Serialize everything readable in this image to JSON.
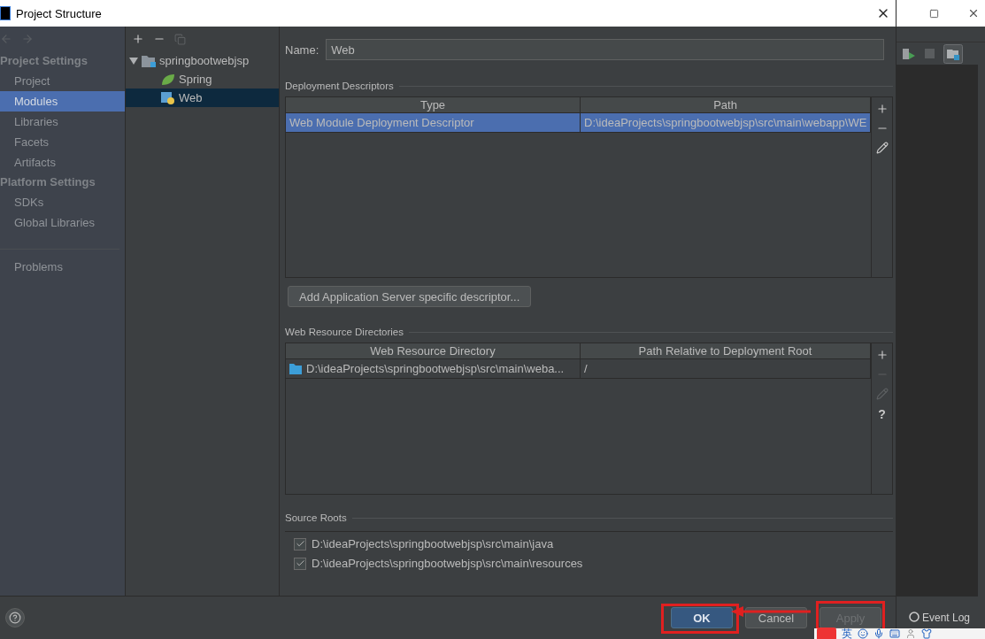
{
  "window": {
    "title": "Project Structure"
  },
  "sidebar": {
    "sections": [
      {
        "heading": "Project Settings",
        "items": [
          {
            "label": "Project",
            "selected": false
          },
          {
            "label": "Modules",
            "selected": true
          },
          {
            "label": "Libraries",
            "selected": false
          },
          {
            "label": "Facets",
            "selected": false
          },
          {
            "label": "Artifacts",
            "selected": false
          }
        ]
      },
      {
        "heading": "Platform Settings",
        "items": [
          {
            "label": "SDKs",
            "selected": false
          },
          {
            "label": "Global Libraries",
            "selected": false
          }
        ]
      }
    ],
    "footer_items": [
      {
        "label": "Problems",
        "selected": false
      }
    ]
  },
  "module_tree": {
    "nodes": [
      {
        "label": "springbootwebjsp",
        "kind": "module",
        "expanded": true,
        "selected": false,
        "children": [
          {
            "label": "Spring",
            "kind": "spring",
            "selected": false
          },
          {
            "label": "Web",
            "kind": "web",
            "selected": true
          }
        ]
      }
    ]
  },
  "name_field": {
    "label": "Name:",
    "value": "Web"
  },
  "deployment_descriptors": {
    "title": "Deployment Descriptors",
    "columns": [
      "Type",
      "Path"
    ],
    "rows": [
      {
        "cells": [
          "Web Module Deployment Descriptor",
          "D:\\ideaProjects\\springbootwebjsp\\src\\main\\webapp\\WE"
        ],
        "selected": true
      }
    ],
    "tools": [
      {
        "kind": "add",
        "disabled": false
      },
      {
        "kind": "remove",
        "disabled": false
      },
      {
        "kind": "edit",
        "disabled": false
      }
    ],
    "button": "Add Application Server specific descriptor..."
  },
  "web_resource_directories": {
    "title": "Web Resource Directories",
    "columns": [
      "Web Resource Directory",
      "Path Relative to Deployment Root"
    ],
    "rows": [
      {
        "cells": [
          "D:\\ideaProjects\\springbootwebjsp\\src\\main\\weba...",
          "/"
        ],
        "selected": false
      }
    ],
    "tools": [
      {
        "kind": "add",
        "disabled": false
      },
      {
        "kind": "remove",
        "disabled": true
      },
      {
        "kind": "edit",
        "disabled": true
      },
      {
        "kind": "help",
        "disabled": false,
        "label": "?"
      }
    ]
  },
  "source_roots": {
    "title": "Source Roots",
    "items": [
      {
        "path": "D:\\ideaProjects\\springbootwebjsp\\src\\main\\java",
        "checked": true
      },
      {
        "path": "D:\\ideaProjects\\springbootwebjsp\\src\\main\\resources",
        "checked": true
      }
    ]
  },
  "buttons": [
    {
      "label": "OK",
      "kind": "primary",
      "disabled": false
    },
    {
      "label": "Cancel",
      "kind": "normal",
      "disabled": false
    },
    {
      "label": "Apply",
      "kind": "normal",
      "disabled": true
    }
  ],
  "ide": {
    "event_log": "Event Log"
  },
  "ime_bar": {
    "label": "英"
  }
}
